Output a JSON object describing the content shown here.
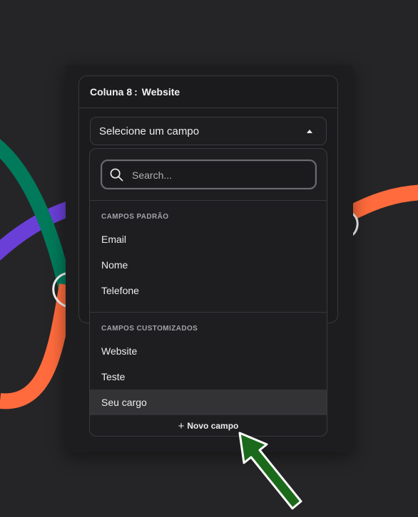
{
  "colors": {
    "background": "#252527",
    "panel": "#1d1d1f",
    "accent_green": "#007a5a",
    "accent_purple": "#6a3fd8",
    "accent_orange": "#ff6b3d",
    "arrow_green": "#1b6a1b"
  },
  "header": {
    "column_label": "Coluna 8",
    "separator": ":",
    "column_value": "Website"
  },
  "select": {
    "placeholder": "Selecione um campo",
    "caret_icon": "caret-up-icon"
  },
  "dropdown": {
    "search_placeholder": "Search...",
    "search_icon": "search-icon",
    "sections": [
      {
        "title": "CAMPOS PADRÃO",
        "items": [
          "Email",
          "Nome",
          "Telefone"
        ]
      },
      {
        "title": "CAMPOS CUSTOMIZADOS",
        "items": [
          "Website",
          "Teste",
          "Seu cargo"
        ]
      }
    ],
    "highlighted_item": "Seu cargo",
    "footer_icon": "+",
    "footer_label": "Novo campo"
  }
}
